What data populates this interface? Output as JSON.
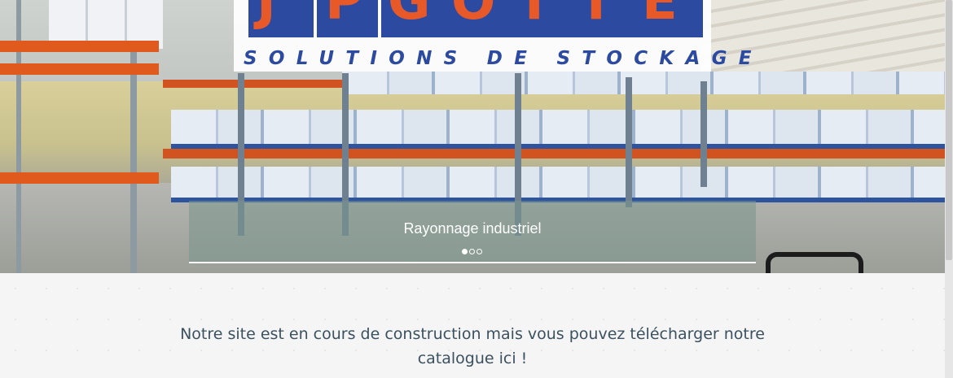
{
  "logo": {
    "letters": [
      "J",
      "P",
      "G",
      "O",
      "T",
      "T",
      "E"
    ],
    "subtitle": "SOLUTIONS DE STOCKAGE",
    "colors": {
      "blue": "#2b4aa0",
      "orange": "#e8592a"
    }
  },
  "slider": {
    "caption": "Rayonnage industriel",
    "dots": [
      {
        "active": true
      },
      {
        "active": false
      },
      {
        "active": false
      }
    ]
  },
  "content": {
    "notice": "Notre site est en cours de construction mais vous pouvez télécharger notre catalogue ici !"
  }
}
